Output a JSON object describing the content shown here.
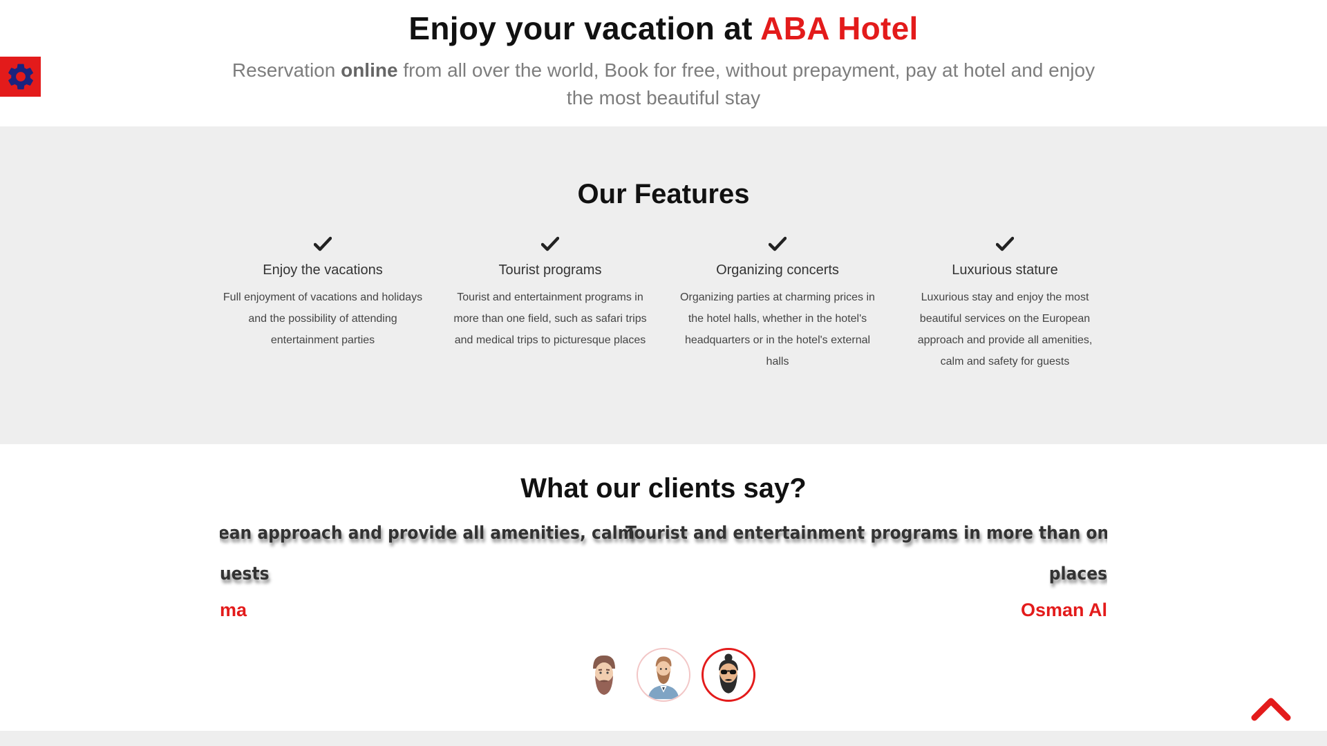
{
  "hero": {
    "title_prefix": "Enjoy your vacation at ",
    "title_brand": "ABA Hotel",
    "subtitle_before": "Reservation ",
    "subtitle_bold": "online",
    "subtitle_after": " from all over the world, Book for free, without prepayment, pay at hotel and enjoy the most beautiful stay"
  },
  "settings": {
    "icon": "gear-icon",
    "icon_color": "#1a237e",
    "background": "#e31b1b"
  },
  "features": {
    "title": "Our Features",
    "items": [
      {
        "icon": "check-icon",
        "title": "Enjoy the vacations",
        "text": "Full enjoyment of vacations and holidays and the possibility of attending entertainment parties"
      },
      {
        "icon": "check-icon",
        "title": "Tourist programs",
        "text": "Tourist and entertainment programs in more than one field, such as safari trips and medical trips to picturesque places"
      },
      {
        "icon": "check-icon",
        "title": "Organizing concerts",
        "text": "Organizing parties at charming prices in the hotel halls, whether in the hotel's headquarters or in the hotel's external halls"
      },
      {
        "icon": "check-icon",
        "title": "Luxurious stature",
        "text": "Luxurious stay and enjoy the most beautiful services on the European approach and provide all amenities, calm and safety for guests"
      }
    ]
  },
  "testimonials": {
    "title": "What our clients say?",
    "slides": [
      {
        "line1": "uropean approach and provide all amenities, calm",
        "line2": "uests",
        "name": "ma"
      },
      {
        "line1": "Tourist and entertainment programs in more than one field, s",
        "line2": "places",
        "name": "Osman Al"
      }
    ],
    "avatars": [
      "avatar-1",
      "avatar-2",
      "avatar-3"
    ],
    "active_avatar": 3
  },
  "colors": {
    "accent": "#e31b1b",
    "section_bg": "#eeeeee",
    "text_dark": "#111111",
    "text_muted": "#7d7d7d"
  },
  "scroll_top": {
    "icon": "chevron-up-icon"
  }
}
